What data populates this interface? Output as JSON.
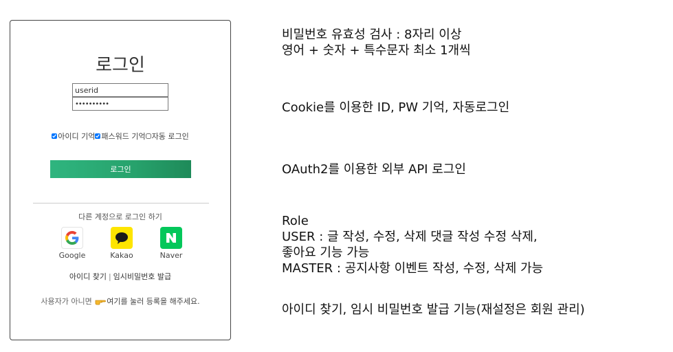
{
  "login_card": {
    "title": "로그인",
    "userid_value": "userid",
    "password_value": "••••••••••",
    "checkboxes": [
      {
        "label": "아이디 기억",
        "checked": true
      },
      {
        "label": "패스워드 기억",
        "checked": true
      },
      {
        "label": "자동 로그인",
        "checked": false
      }
    ],
    "login_button": "로그인",
    "other_login_text": "다른 계정으로 로그인 하기",
    "social": [
      {
        "name": "Google",
        "icon": "google-icon"
      },
      {
        "name": "Kakao",
        "icon": "kakao-icon"
      },
      {
        "name": "Naver",
        "icon": "naver-icon"
      }
    ],
    "find_id": "아이디 찾기",
    "separator": "|",
    "temp_password": "임시비밀번호 발급",
    "signup_prefix": "사용자가 아니면",
    "signup_link": "여기를 눌러 등록을 해주세요."
  },
  "notes": {
    "password_rule_1": "비밀번호 유효성 검사 : 8자리 이상",
    "password_rule_2": "영어 + 숫자 + 특수문자 최소 1개씩",
    "cookie": "Cookie를 이용한 ID, PW 기억, 자동로그인",
    "oauth": "OAuth2를 이용한 외부 API 로그인",
    "role_title": "Role",
    "role_user_1": "USER : 글 작성, 수정, 삭제 댓글 작성 수정 삭제,",
    "role_user_2": "좋아요 기능 가능",
    "role_master": "MASTER : 공지사항 이벤트 작성, 수정, 삭제 가능",
    "find_feature": "아이디 찾기, 임시 비밀번호 발급 기능(재설정은 회원 관리)"
  },
  "colors": {
    "login_button": "#27a26c",
    "kakao": "#fee500",
    "naver": "#03c75a"
  }
}
